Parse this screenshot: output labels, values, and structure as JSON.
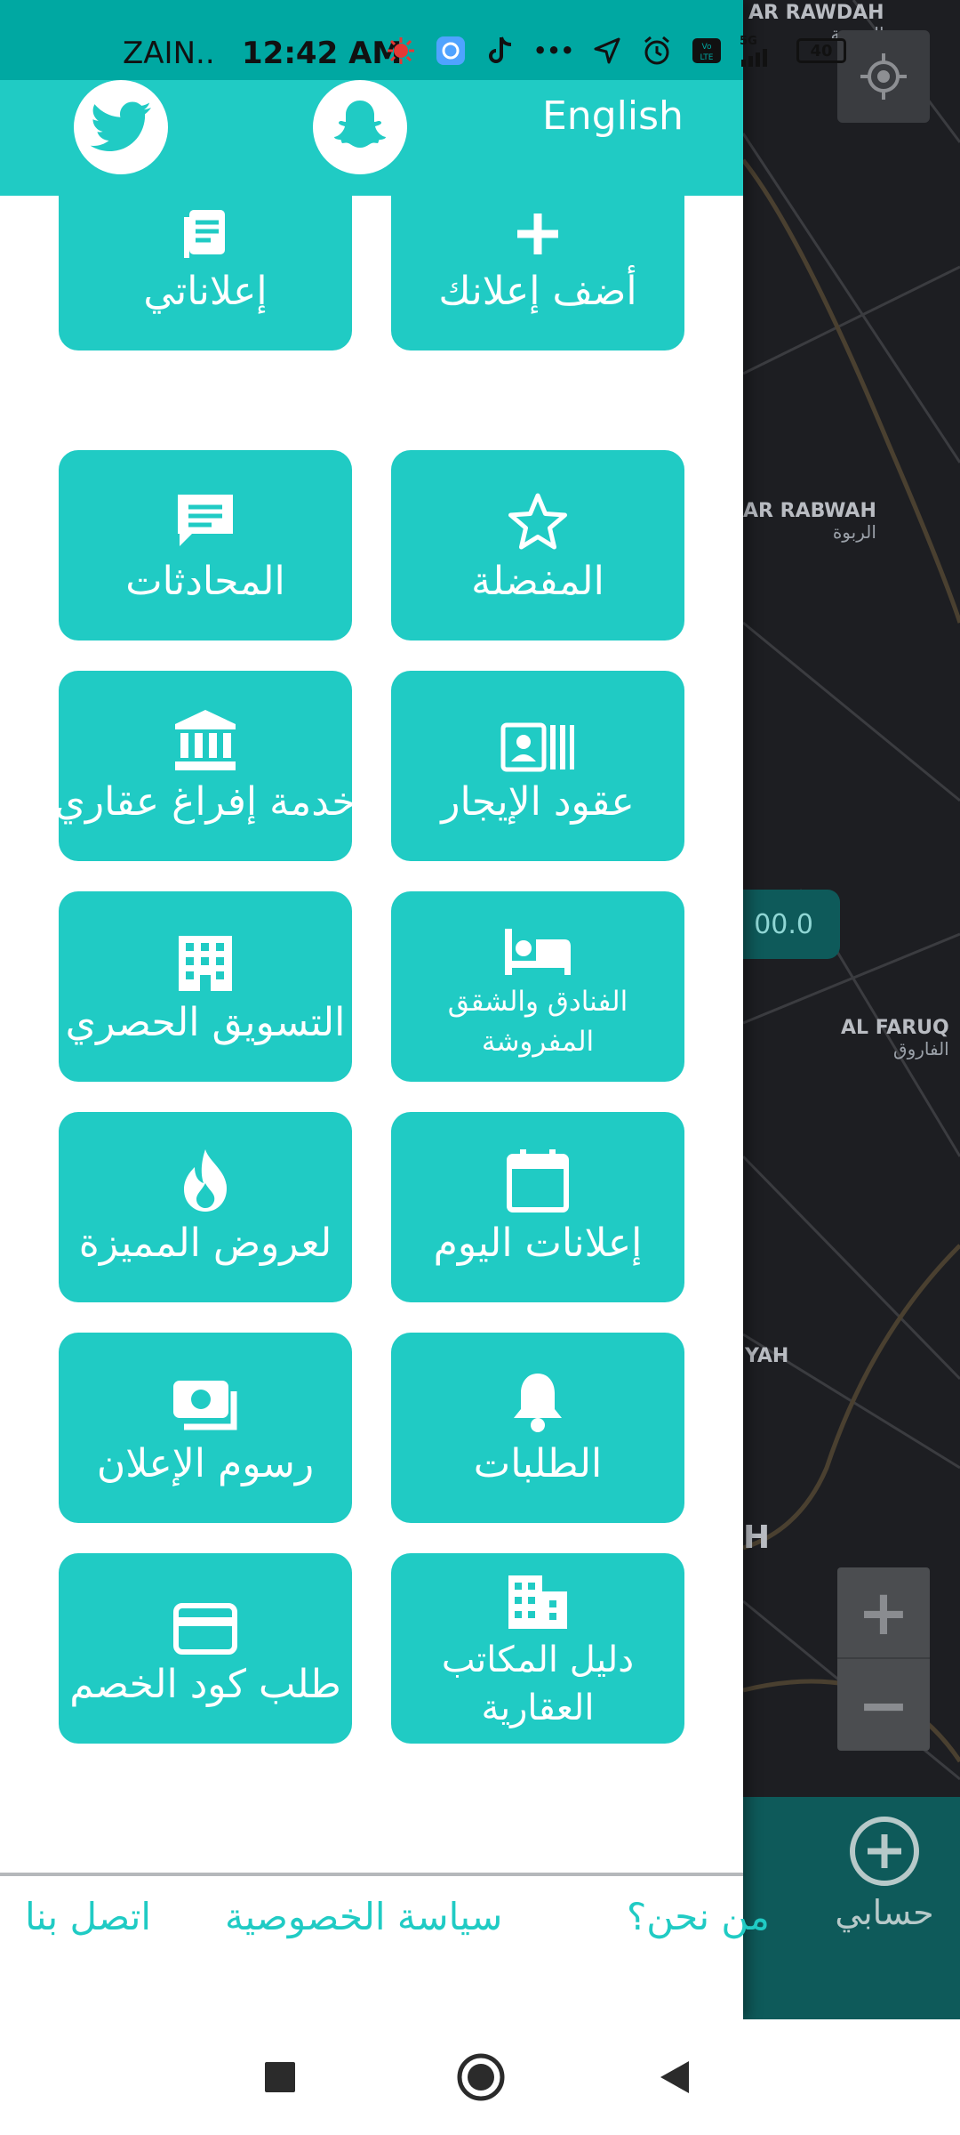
{
  "status_bar": {
    "carrier": "ZAIN..",
    "time": "12:42 AM",
    "ellipsis": "•••",
    "battery": "40",
    "network": "5G"
  },
  "map": {
    "labels": [
      {
        "en": "AR RAWDAH",
        "ar": "الروضة"
      },
      {
        "en": "AR RABWAH",
        "ar": "الربوة"
      },
      {
        "en": "AL FARUQ",
        "ar": "الفاروق"
      },
      {
        "en": "YAH",
        "ar": ""
      },
      {
        "en": "H",
        "ar": ""
      }
    ],
    "price_pill": "00.0",
    "zoom_in": "+",
    "zoom_out": "−",
    "account_label": "حسابي"
  },
  "drawer": {
    "language": "English",
    "tiles": [
      {
        "label": "أضف إعلانك",
        "icon": "plus-icon"
      },
      {
        "label": "إعلاناتي",
        "icon": "document-icon"
      },
      {
        "label": "المفضلة",
        "icon": "star-icon"
      },
      {
        "label": "المحادثات",
        "icon": "chat-icon"
      },
      {
        "label": "عقود الإيجار",
        "icon": "contract-icon"
      },
      {
        "label": "خدمة إفراغ عقاري",
        "icon": "bank-icon"
      },
      {
        "label": "الفنادق والشقق المفروشة",
        "icon": "bed-icon"
      },
      {
        "label": "التسويق الحصري",
        "icon": "building-icon"
      },
      {
        "label": "إعلانات اليوم",
        "icon": "calendar-icon"
      },
      {
        "label": "لعروض المميزة",
        "icon": "fire-icon"
      },
      {
        "label": "الطلبات",
        "icon": "bell-icon"
      },
      {
        "label": "رسوم الإعلان",
        "icon": "money-icon"
      },
      {
        "label": "دليل المكاتب العقارية",
        "icon": "office-building-icon"
      },
      {
        "label": "طلب كود الخصم",
        "icon": "credit-card-icon"
      }
    ],
    "footer_links": {
      "about": "من نحن؟",
      "privacy": "سياسة الخصوصية",
      "contact": "اتصل بنا"
    }
  },
  "colors": {
    "accent": "#20cbc4",
    "status_bar": "#00a8a2",
    "map_bg": "#1d1e22",
    "map_bottom_bar": "#0e5a5a"
  }
}
